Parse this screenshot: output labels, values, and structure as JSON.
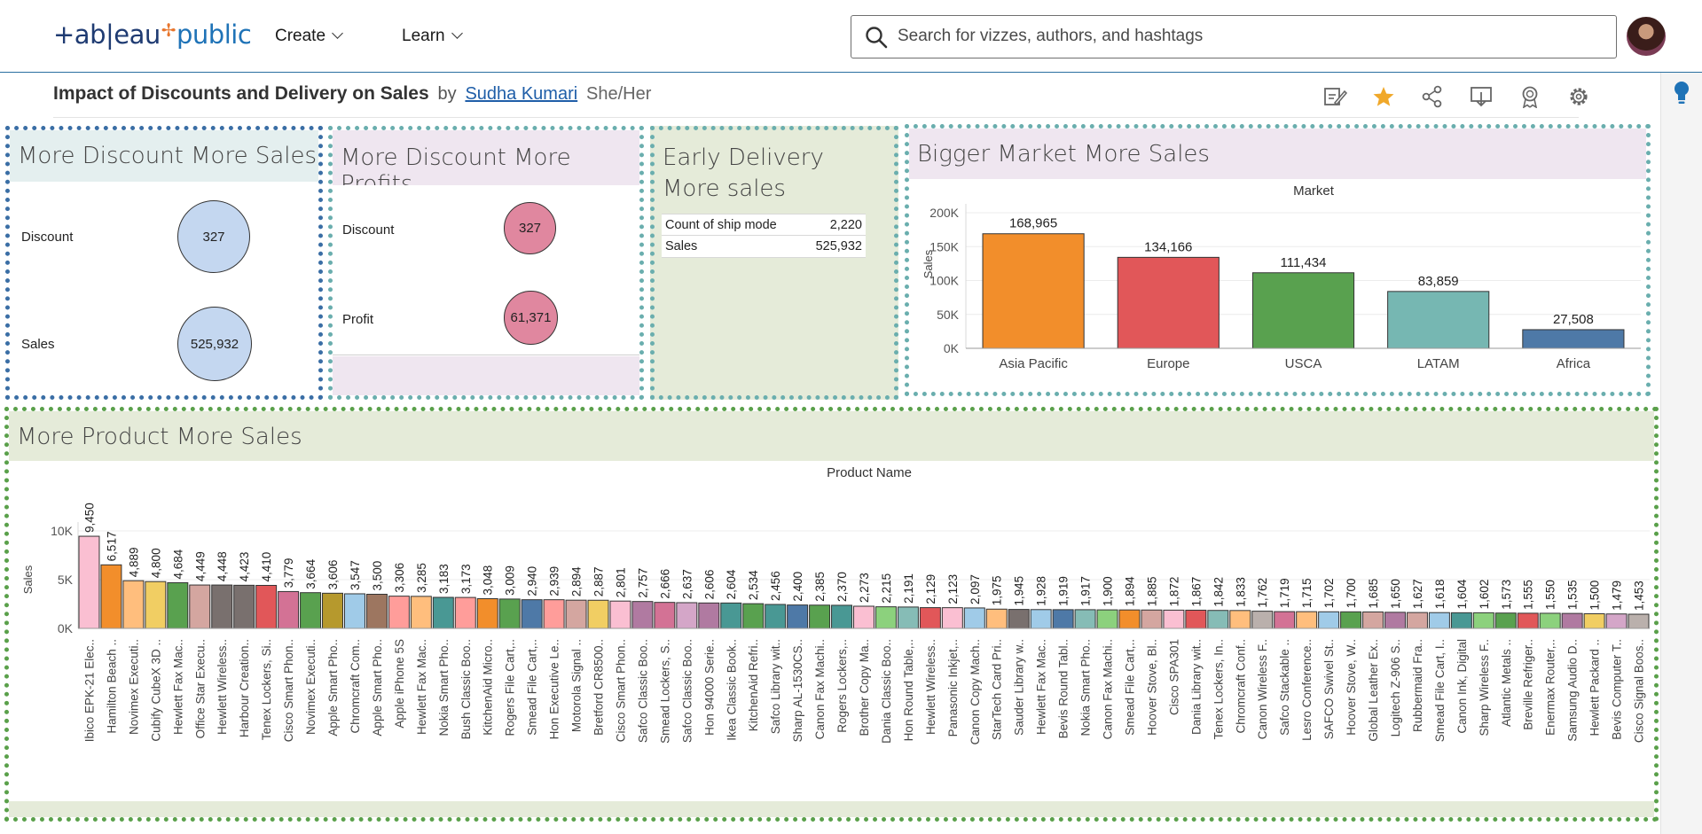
{
  "header": {
    "logo_left": "+ab|eau",
    "logo_right": "public",
    "nav": [
      {
        "label": "Create"
      },
      {
        "label": "Learn"
      }
    ],
    "search_placeholder": "Search for vizzes, authors, and hashtags"
  },
  "viz": {
    "title": "Impact of Discounts and Delivery on Sales",
    "by": "by",
    "author": "Sudha Kumari",
    "pronoun": "She/Her",
    "toolbar_icons": [
      "edit-icon",
      "favorite-star-icon",
      "share-icon",
      "download-icon",
      "badge-icon",
      "settings-icon"
    ]
  },
  "panels": {
    "p1": {
      "title": "More Discount More Sales",
      "rows": [
        {
          "label": "Discount",
          "value": "327"
        },
        {
          "label": "Sales",
          "value": "525,932"
        }
      ]
    },
    "p2": {
      "title": "More Discount More Profits",
      "rows": [
        {
          "label": "Discount",
          "value": "327"
        },
        {
          "label": "Profit",
          "value": "61,371"
        }
      ]
    },
    "p3": {
      "title_line1": "Early Delivery",
      "title_line2": "More sales",
      "rows": [
        {
          "label": "Count of ship mode",
          "value": "2,220"
        },
        {
          "label": "Sales",
          "value": "525,932"
        }
      ]
    },
    "p4": {
      "title": "Bigger Market More Sales"
    },
    "p5": {
      "title": "More Product More Sales"
    }
  },
  "colors": {
    "panel_blue_bg": "#e4efef",
    "panel_pink_bg": "#efe6f0",
    "panel_green_bg": "#e5ebd9",
    "border_blue": "#3a6ea5",
    "border_teal": "#6aaeae",
    "border_green": "#5aa04a",
    "circle_blue": "#c4d7f0",
    "circle_pink": "#e0879f"
  },
  "chart_data": [
    {
      "type": "bar",
      "header": "Market",
      "ylabel": "Sales",
      "ylim": [
        0,
        200000
      ],
      "yticks": [
        {
          "v": 0,
          "label": "0K"
        },
        {
          "v": 50000,
          "label": "50K"
        },
        {
          "v": 100000,
          "label": "100K"
        },
        {
          "v": 150000,
          "label": "150K"
        },
        {
          "v": 200000,
          "label": "200K"
        }
      ],
      "categories": [
        "Asia Pacific",
        "Europe",
        "USCA",
        "LATAM",
        "Africa"
      ],
      "values": [
        168965,
        134166,
        111434,
        83859,
        27508
      ],
      "labels": [
        "168,965",
        "134,166",
        "111,434",
        "83,859",
        "27,508"
      ],
      "colors": [
        "#f28e2b",
        "#e15759",
        "#59a14f",
        "#76b7b2",
        "#4e79a7"
      ]
    },
    {
      "type": "bar",
      "header": "Product Name",
      "ylabel": "Sales",
      "ylim": [
        0,
        10000
      ],
      "yticks": [
        {
          "v": 0,
          "label": "0K"
        },
        {
          "v": 5000,
          "label": "5K"
        },
        {
          "v": 10000,
          "label": "10K"
        }
      ],
      "categories": [
        "Ibico EPK-21 Elec..",
        "Hamilton Beach ..",
        "Novimex Executi..",
        "Cubify CubeX 3D ..",
        "Hewlett Fax Mac..",
        "Office Star Execu..",
        "Hewlett Wireless..",
        "Harbour Creation..",
        "Tenex Lockers, Si..",
        "Cisco Smart Phon..",
        "Novimex Executi..",
        "Apple Smart Pho..",
        "Chromcraft Com..",
        "Apple Smart Pho..",
        "Apple iPhone 5S",
        "Hewlett Fax Mac..",
        "Nokia Smart Pho..",
        "Bush Classic Boo..",
        "KitchenAid Micro..",
        "Rogers File Cart,..",
        "Smead File Cart,..",
        "Hon Executive Le..",
        "Motorola Signal ..",
        "Bretford CR8500..",
        "Cisco Smart Phon..",
        "Safco Classic Boo..",
        "Smead Lockers, S..",
        "Safco Classic Boo..",
        "Hon 94000 Serie..",
        "Ikea Classic Book..",
        "KitchenAid Refri..",
        "Safco Library wit..",
        "Sharp AL-1530CS..",
        "Canon Fax Machi..",
        "Rogers Lockers,..",
        "Brother Copy Ma..",
        "Dania Classic Boo..",
        "Hon Round Table,..",
        "Hewlett Wireless..",
        "Panasonic Inkjet,..",
        "Canon Copy Mach..",
        "StarTech Card Pri..",
        "Sauder Library w..",
        "Hewlett Fax Mac..",
        "Bevis Round Tabl..",
        "Nokia Smart Pho..",
        "Canon Fax Machi..",
        "Smead File Cart,..",
        "Hoover Stove, Bl..",
        "Cisco SPA301",
        "Dania Library wit..",
        "Tenex Lockers, In..",
        "Chromcraft Conf..",
        "Canon Wireless F..",
        "Safco Stackable ..",
        "Lesro Conference..",
        "SAFCO Swivel St..",
        "Hoover Stove, W..",
        "Global Leather Ex..",
        "Logitech Z-906 S..",
        "Rubbermaid Fra..",
        "Smead File Cart, I..",
        "Canon Ink, Digital",
        "Sharp Wireless F..",
        "Atlantic Metals ..",
        "Breville Refriger..",
        "Enermax Router,..",
        "Samsung Audio D..",
        "Hewlett Packard ..",
        "Bevis Computer T..",
        "Cisco Signal Boos.."
      ],
      "values": [
        9450,
        6517,
        4889,
        4800,
        4684,
        4449,
        4448,
        4423,
        4410,
        3779,
        3664,
        3606,
        3547,
        3500,
        3306,
        3285,
        3183,
        3173,
        3048,
        3009,
        2940,
        2939,
        2894,
        2887,
        2801,
        2757,
        2666,
        2637,
        2606,
        2604,
        2534,
        2456,
        2400,
        2385,
        2370,
        2273,
        2215,
        2191,
        2129,
        2123,
        2097,
        1975,
        1945,
        1928,
        1919,
        1917,
        1900,
        1894,
        1885,
        1872,
        1867,
        1842,
        1833,
        1762,
        1719,
        1715,
        1702,
        1700,
        1685,
        1650,
        1627,
        1618,
        1604,
        1602,
        1573,
        1555,
        1550,
        1535,
        1500,
        1479,
        1453
      ],
      "labels": [
        "9,450",
        "6,517",
        "4,889",
        "4,800",
        "4,684",
        "4,449",
        "4,448",
        "4,423",
        "4,410",
        "3,779",
        "3,664",
        "3,606",
        "3,547",
        "3,500",
        "3,306",
        "3,285",
        "3,183",
        "3,173",
        "3,048",
        "3,009",
        "2,940",
        "2,939",
        "2,894",
        "2,887",
        "2,801",
        "2,757",
        "2,666",
        "2,637",
        "2,606",
        "2,604",
        "2,534",
        "2,456",
        "2,400",
        "2,385",
        "2,370",
        "2,273",
        "2,215",
        "2,191",
        "2,129",
        "2,123",
        "2,097",
        "1,975",
        "1,945",
        "1,928",
        "1,919",
        "1,917",
        "1,900",
        "1,894",
        "1,885",
        "1,872",
        "1,867",
        "1,842",
        "1,833",
        "1,762",
        "1,719",
        "1,715",
        "1,702",
        "1,700",
        "1,685",
        "1,650",
        "1,627",
        "1,618",
        "1,604",
        "1,602",
        "1,573",
        "1,555",
        "1,550",
        "1,535",
        "1,500",
        "1,479",
        "1,453"
      ],
      "palette": [
        "#fabfd2",
        "#f28e2b",
        "#ffbe7d",
        "#f1ce63",
        "#59a14f",
        "#d4a6a0",
        "#79706e",
        "#79706e",
        "#e15759",
        "#d37295",
        "#59a14f",
        "#b6992d",
        "#a0cbe8",
        "#9d7660",
        "#ff9d9a",
        "#ffbe7d",
        "#499894",
        "#ff9d9a",
        "#f28e2b",
        "#59a14f",
        "#4e79a7",
        "#ff9d9a",
        "#d4a6a0",
        "#f1ce63",
        "#fabfd2",
        "#b07aa1",
        "#d37295",
        "#d4a6c8",
        "#b07aa1",
        "#499894",
        "#59a14f",
        "#499894",
        "#4e79a7",
        "#59a14f",
        "#499894",
        "#fabfd2",
        "#8cd17d",
        "#86bcb6",
        "#e15759",
        "#fabfd2",
        "#a0cbe8",
        "#ffbe7d",
        "#79706e",
        "#a0cbe8",
        "#4e79a7",
        "#86bcb6",
        "#8cd17d",
        "#f28e2b",
        "#d4a6a0",
        "#fabfd2",
        "#e15759",
        "#86bcb6",
        "#ffbe7d",
        "#bab0ac",
        "#d37295",
        "#ffbe7d",
        "#a0cbe8",
        "#59a14f",
        "#d4a6a0",
        "#b07aa1",
        "#d4a6a0",
        "#a0cbe8",
        "#499894",
        "#8cd17d",
        "#59a14f",
        "#e15759",
        "#8cd17d",
        "#b07aa1",
        "#f1ce63",
        "#d4a6c8",
        "#bab0ac"
      ]
    }
  ]
}
